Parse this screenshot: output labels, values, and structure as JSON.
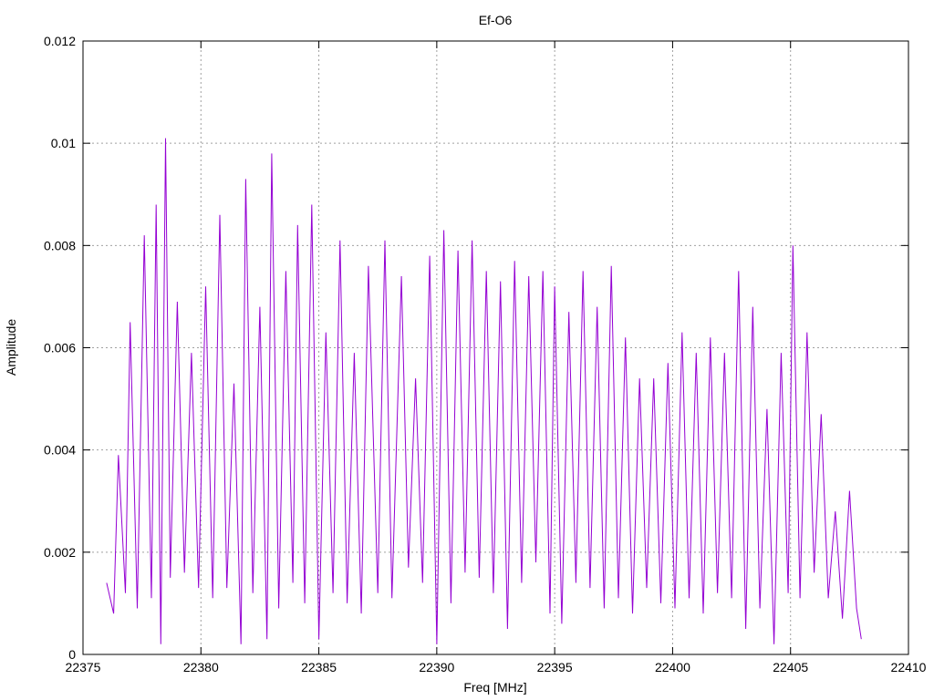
{
  "chart_data": {
    "type": "line",
    "title": "Ef-O6",
    "xlabel": "Freq [MHz]",
    "ylabel": "Amplitude",
    "xlim": [
      22375,
      22410
    ],
    "ylim": [
      0,
      0.012
    ],
    "x_ticks": [
      22375,
      22380,
      22385,
      22390,
      22395,
      22400,
      22405,
      22410
    ],
    "x_tick_labels": [
      "22375",
      "22380",
      "22385",
      "22390",
      "22395",
      "22400",
      "22405",
      "22410"
    ],
    "y_ticks": [
      0,
      0.002,
      0.004,
      0.006,
      0.008,
      0.01,
      0.012
    ],
    "y_tick_labels": [
      "0",
      "0.002",
      "0.004",
      "0.006",
      "0.008",
      "0.01",
      "0.012"
    ],
    "grid": true,
    "line_color": "#9400d3",
    "series": [
      {
        "x": [
          22376.0,
          22376.3,
          22376.5,
          22376.8,
          22377.0,
          22377.3,
          22377.6,
          22377.9,
          22378.1,
          22378.3,
          22378.5,
          22378.7,
          22379.0,
          22379.3,
          22379.6,
          22379.9,
          22380.2,
          22380.5,
          22380.8,
          22381.1,
          22381.4,
          22381.7,
          22381.9,
          22382.2,
          22382.5,
          22382.8,
          22383.0,
          22383.3,
          22383.6,
          22383.9,
          22384.1,
          22384.4,
          22384.7,
          22385.0,
          22385.3,
          22385.6,
          22385.9,
          22386.2,
          22386.5,
          22386.8,
          22387.1,
          22387.5,
          22387.8,
          22388.1,
          22388.5,
          22388.8,
          22389.1,
          22389.4,
          22389.7,
          22390.0,
          22390.3,
          22390.6,
          22390.9,
          22391.2,
          22391.5,
          22391.8,
          22392.1,
          22392.4,
          22392.7,
          22393.0,
          22393.3,
          22393.6,
          22393.9,
          22394.2,
          22394.5,
          22394.8,
          22395.0,
          22395.3,
          22395.6,
          22395.9,
          22396.2,
          22396.5,
          22396.8,
          22397.1,
          22397.4,
          22397.7,
          22398.0,
          22398.3,
          22398.6,
          22398.9,
          22399.2,
          22399.5,
          22399.8,
          22400.1,
          22400.4,
          22400.7,
          22401.0,
          22401.3,
          22401.6,
          22401.9,
          22402.2,
          22402.5,
          22402.8,
          22403.1,
          22403.4,
          22403.7,
          22404.0,
          22404.3,
          22404.6,
          22404.9,
          22405.1,
          22405.4,
          22405.7,
          22406.0,
          22406.3,
          22406.6,
          22406.9,
          22407.2,
          22407.5,
          22407.8,
          22408.0
        ],
        "y": [
          0.0014,
          0.0008,
          0.0039,
          0.0012,
          0.0065,
          0.0009,
          0.0082,
          0.0011,
          0.0088,
          0.0002,
          0.0101,
          0.0015,
          0.0069,
          0.0016,
          0.0059,
          0.0013,
          0.0072,
          0.0011,
          0.0086,
          0.0013,
          0.0053,
          0.0002,
          0.0093,
          0.0012,
          0.0068,
          0.0003,
          0.0098,
          0.0009,
          0.0075,
          0.0014,
          0.0084,
          0.001,
          0.0088,
          0.0003,
          0.0063,
          0.0012,
          0.0081,
          0.001,
          0.0059,
          0.0008,
          0.0076,
          0.0012,
          0.0081,
          0.0011,
          0.0074,
          0.0017,
          0.0054,
          0.0014,
          0.0078,
          0.0002,
          0.0083,
          0.001,
          0.0079,
          0.0016,
          0.0081,
          0.0015,
          0.0075,
          0.0012,
          0.0073,
          0.0005,
          0.0077,
          0.0014,
          0.0074,
          0.0018,
          0.0075,
          0.0008,
          0.0072,
          0.0006,
          0.0067,
          0.0014,
          0.0075,
          0.0013,
          0.0068,
          0.0009,
          0.0076,
          0.0011,
          0.0062,
          0.0008,
          0.0054,
          0.0013,
          0.0054,
          0.001,
          0.0057,
          0.0009,
          0.0063,
          0.0011,
          0.0059,
          0.0008,
          0.0062,
          0.0012,
          0.0059,
          0.0011,
          0.0075,
          0.0005,
          0.0068,
          0.0009,
          0.0048,
          0.0002,
          0.0059,
          0.0012,
          0.008,
          0.0011,
          0.0063,
          0.0016,
          0.0047,
          0.0011,
          0.0028,
          0.0007,
          0.0032,
          0.0009,
          0.0003
        ]
      }
    ]
  }
}
